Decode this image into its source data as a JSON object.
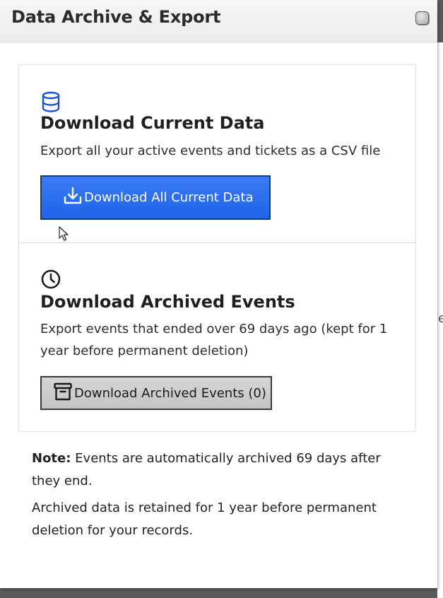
{
  "modal": {
    "title": "Data Archive & Export"
  },
  "current": {
    "icon": "database-icon",
    "title": "Download Current Data",
    "description": "Export all your active events and tickets as a CSV file",
    "button_label": "Download All Current Data",
    "button_icon": "download-icon"
  },
  "archived": {
    "icon": "clock-icon",
    "title": "Download Archived Events",
    "description": "Export events that ended over 69 days ago (kept for 1 year before permanent deletion)",
    "button_label": "Download Archived Events (0)",
    "button_icon": "archive-box-icon"
  },
  "note": {
    "label": "Note:",
    "line1": " Events are automatically archived 69 days after they end.",
    "line2": "Archived data is retained for 1 year before permanent deletion for your records."
  },
  "background": {
    "fragment": "e"
  },
  "colors": {
    "primary_button": "#2a6ef0",
    "secondary_button": "#cfcfcf",
    "icon_blue": "#1f4fd1"
  }
}
